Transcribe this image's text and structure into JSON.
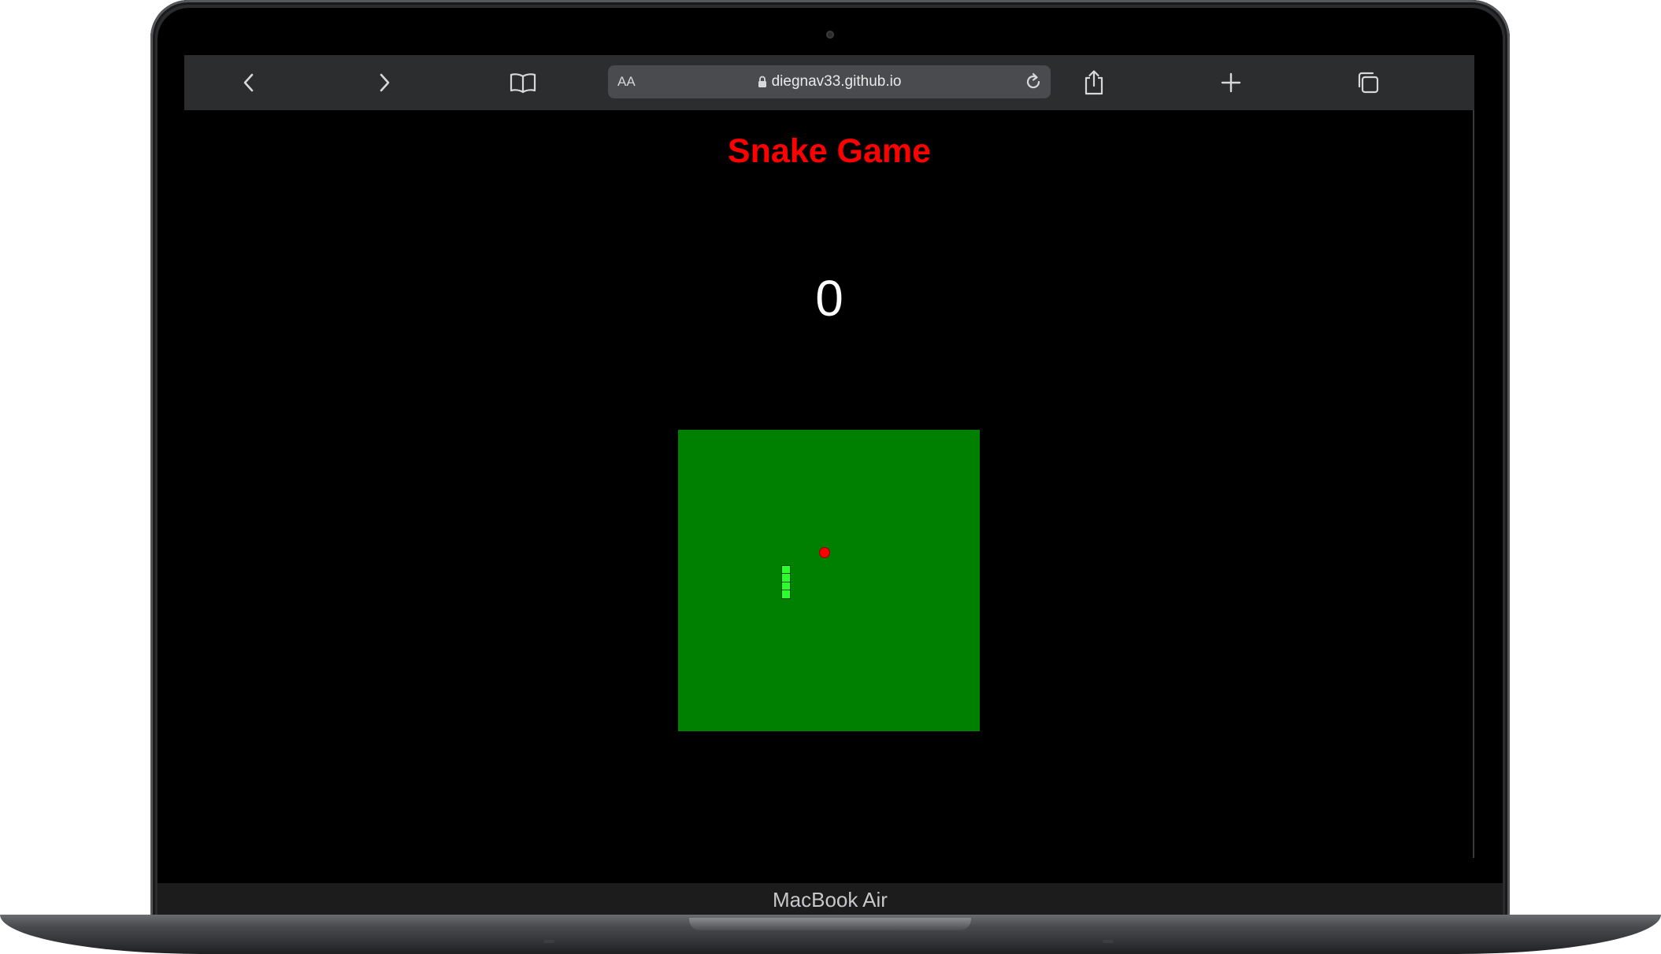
{
  "browser": {
    "reader_label": "AA",
    "url": "diegnav33.github.io",
    "buttons": {
      "back": "chevron-left-icon",
      "forward": "chevron-right-icon",
      "bookmarks": "book-icon",
      "reload": "reload-icon",
      "share": "share-icon",
      "new_tab": "plus-icon",
      "tabs": "tabs-icon"
    }
  },
  "page": {
    "title": "Snake Game",
    "score": "0"
  },
  "game": {
    "board_color": "#008000",
    "snake_color": "#2bff2b",
    "food_color": "#ff0000",
    "grid_cells": 38,
    "food": {
      "col": 18,
      "row": 15
    },
    "snake": [
      {
        "col": 13,
        "row": 17
      },
      {
        "col": 13,
        "row": 18
      },
      {
        "col": 13,
        "row": 19
      },
      {
        "col": 13,
        "row": 20
      }
    ]
  },
  "device": {
    "model": "MacBook Air"
  },
  "colors": {
    "title": "#ff0000",
    "score": "#ffffff",
    "toolbar": "#2c2d2f",
    "address_bar": "#4a4b4e"
  }
}
